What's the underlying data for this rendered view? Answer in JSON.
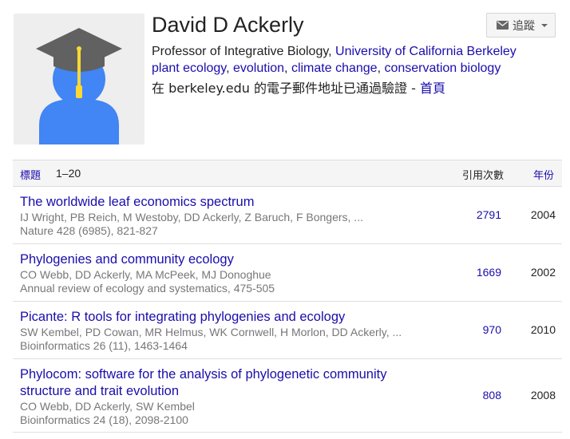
{
  "profile": {
    "name": "David D Ackerly",
    "position": "Professor of Integrative Biology, ",
    "institution": "University of California Berkeley",
    "interests": [
      "plant ecology",
      "evolution",
      "climate change",
      "conservation biology"
    ],
    "interest_separator": ", ",
    "verified_text": "在 berkeley.edu 的電子郵件地址已通過驗證 - ",
    "homepage_label": "首頁"
  },
  "follow_button": {
    "label": "追蹤"
  },
  "table": {
    "header_title": "標題",
    "header_range": "1–20",
    "header_cites": "引用次數",
    "header_year": "年份"
  },
  "articles": [
    {
      "title": "The worldwide leaf economics spectrum",
      "authors": "IJ Wright, PB Reich, M Westoby, DD Ackerly, Z Baruch, F Bongers, ...",
      "venue": "Nature 428 (6985), 821-827",
      "cites": "2791",
      "year": "2004"
    },
    {
      "title": "Phylogenies and community ecology",
      "authors": "CO Webb, DD Ackerly, MA McPeek, MJ Donoghue",
      "venue": "Annual review of ecology and systematics, 475-505",
      "cites": "1669",
      "year": "2002"
    },
    {
      "title": "Picante: R tools for integrating phylogenies and ecology",
      "authors": "SW Kembel, PD Cowan, MR Helmus, WK Cornwell, H Morlon, DD Ackerly, ...",
      "venue": "Bioinformatics 26 (11), 1463-1464",
      "cites": "970",
      "year": "2010"
    },
    {
      "title": "Phylocom: software for the analysis of phylogenetic community structure and trait evolution",
      "authors": "CO Webb, DD Ackerly, SW Kembel",
      "venue": "Bioinformatics 24 (18), 2098-2100",
      "cites": "808",
      "year": "2008"
    }
  ],
  "colors": {
    "link": "#1a0dab",
    "meta_text": "#777777",
    "avatar_body": "#4285f4",
    "avatar_cap": "#616161",
    "avatar_tassel": "#fdd835"
  },
  "icons": {
    "avatar": "graduate-avatar-icon",
    "follow": "envelope-icon",
    "dropdown": "caret-down-icon"
  }
}
